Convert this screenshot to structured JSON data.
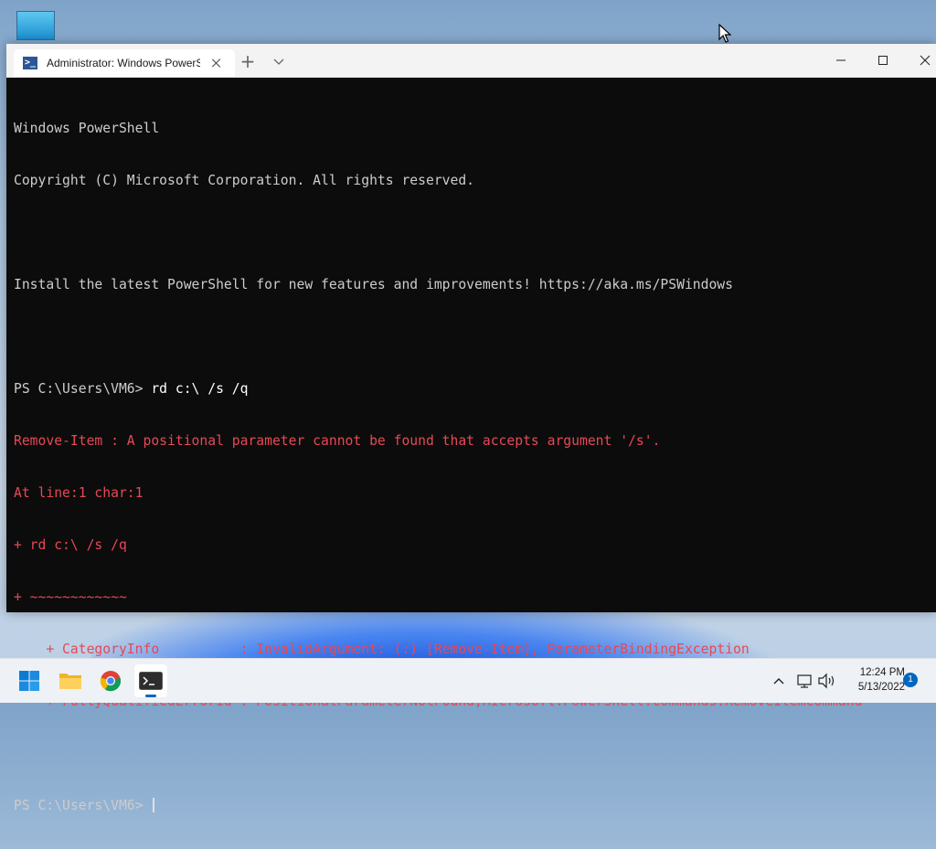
{
  "window": {
    "tab_title": "Administrator: Windows PowerS",
    "tab_icon": "powershell-icon"
  },
  "console": {
    "lines": [
      {
        "text": "Windows PowerShell",
        "kind": "normal"
      },
      {
        "text": "Copyright (C) Microsoft Corporation. All rights reserved.",
        "kind": "normal"
      },
      {
        "text": "",
        "kind": "normal"
      },
      {
        "text": "Install the latest PowerShell for new features and improvements! https://aka.ms/PSWindows",
        "kind": "normal"
      },
      {
        "text": "",
        "kind": "normal"
      },
      {
        "prompt": "PS C:\\Users\\VM6> ",
        "command": "rd c:\\ /s /q",
        "kind": "prompt"
      },
      {
        "text": "Remove-Item : A positional parameter cannot be found that accepts argument '/s'.",
        "kind": "error"
      },
      {
        "text": "At line:1 char:1",
        "kind": "error"
      },
      {
        "text": "+ rd c:\\ /s /q",
        "kind": "error"
      },
      {
        "text": "+ ~~~~~~~~~~~~",
        "kind": "error"
      },
      {
        "text": "    + CategoryInfo          : InvalidArgument: (:) [Remove-Item], ParameterBindingException",
        "kind": "error"
      },
      {
        "text": "    + FullyQualifiedErrorId : PositionalParameterNotFound,Microsoft.PowerShell.Commands.RemoveItemCommand",
        "kind": "error"
      },
      {
        "text": "",
        "kind": "normal"
      },
      {
        "prompt": "PS C:\\Users\\VM6> ",
        "command": "",
        "kind": "prompt-active"
      }
    ]
  },
  "taskbar": {
    "time": "12:24 PM",
    "date": "5/13/2022",
    "notification_count": "1",
    "apps": [
      "windows-start-icon",
      "file-explorer-icon",
      "chrome-icon",
      "terminal-icon"
    ]
  },
  "colors": {
    "console_bg": "#0c0c0c",
    "console_fg": "#cccccc",
    "error": "#e74856",
    "accent": "#0067c0"
  }
}
